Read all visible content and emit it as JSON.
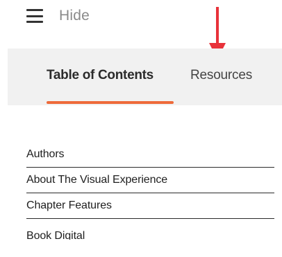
{
  "header": {
    "menu_icon": "hamburger-icon",
    "toggle_label": "Hide"
  },
  "annotation": {
    "icon": "arrow-down-icon",
    "color": "#e8323a"
  },
  "tabs": [
    {
      "label": "Table of Contents",
      "active": true
    },
    {
      "label": "Resources",
      "active": false
    }
  ],
  "accent_color": "#ee6a3a",
  "chapters": [
    {
      "label": "Authors"
    },
    {
      "label": "About The Visual Experience"
    },
    {
      "label": "Chapter Features"
    },
    {
      "label": "Book Digital"
    }
  ]
}
